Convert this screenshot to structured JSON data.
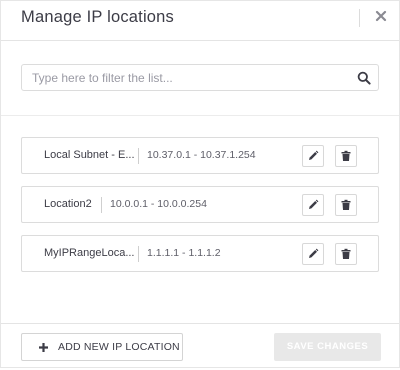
{
  "dialog": {
    "title": "Manage IP locations"
  },
  "search": {
    "placeholder": "Type here to filter the list...",
    "value": ""
  },
  "icons": {
    "close": "close-icon",
    "search": "search-icon",
    "edit": "pencil-icon",
    "delete": "trash-icon",
    "add": "plus-icon"
  },
  "locations": [
    {
      "name": "Local Subnet - E...",
      "range": "10.37.0.1 - 10.37.1.254"
    },
    {
      "name": "Location2",
      "range": "10.0.0.1 - 10.0.0.254"
    },
    {
      "name": "MyIPRangeLoca...",
      "range": "1.1.1.1 - 1.1.1.2"
    }
  ],
  "footer": {
    "add_label": "ADD NEW IP LOCATION",
    "save_label": "SAVE CHANGES"
  },
  "colors": {
    "text": "#3c3c46",
    "border": "#dcdcdc",
    "save_disabled_bg": "#e8e8e8"
  }
}
